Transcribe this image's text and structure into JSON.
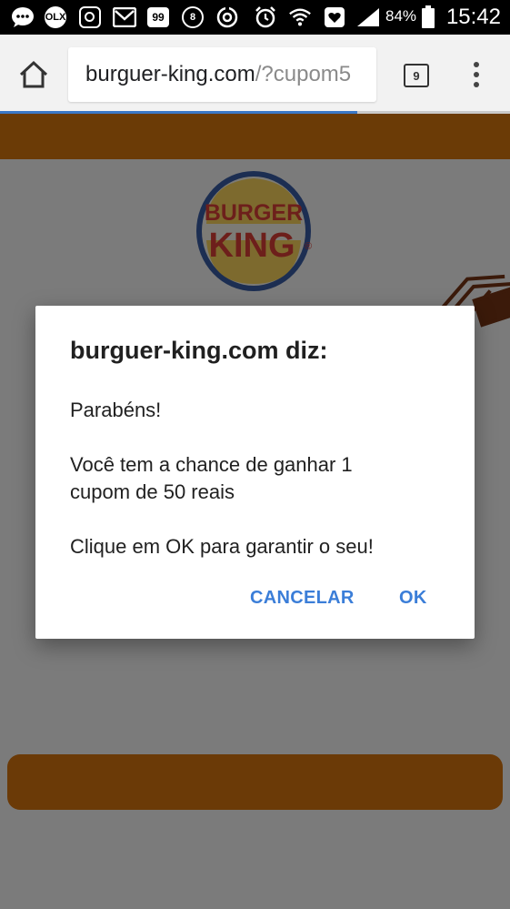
{
  "status_bar": {
    "battery": "84%",
    "time": "15:42",
    "icons": [
      "chat-bubble-icon",
      "olx-icon",
      "instagram-icon",
      "gmail-icon",
      "99-icon",
      "8ball-icon",
      "sync-icon",
      "alarm-icon",
      "wifi-icon",
      "heart-icon",
      "signal-icon",
      "battery-icon"
    ],
    "olx_label": "OLX",
    "app_99_label": "99",
    "ball_label": "8"
  },
  "browser": {
    "url_host": "burguer-king.com",
    "url_path": "/?cupom5",
    "tab_count": "9",
    "load_progress": 0.7,
    "accent_color": "#3b78c7"
  },
  "page": {
    "brand_color": "#6b3b06",
    "logo_top": "BURGER",
    "logo_bottom": "KING",
    "logo_mark": "®"
  },
  "dialog": {
    "title": "burguer-king.com diz:",
    "line1": "Parabéns!",
    "line2": "Você tem a chance de ganhar 1",
    "line3": "cupom de 50 reais",
    "line4": "Clique em OK para garantir o seu!",
    "cancel_label": "CANCELAR",
    "ok_label": "OK",
    "button_color": "#3b7ed8"
  }
}
